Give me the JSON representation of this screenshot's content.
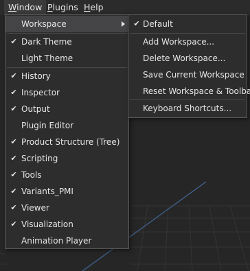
{
  "menubar": {
    "items": [
      {
        "label_first": "W",
        "label_rest": "indow"
      },
      {
        "label_first": "P",
        "label_rest": "lugins"
      },
      {
        "label_first": "H",
        "label_rest": "elp"
      }
    ]
  },
  "window_menu": {
    "workspace": "Workspace",
    "themes": [
      {
        "label": "Dark Theme",
        "checked": true
      },
      {
        "label": "Light Theme",
        "checked": false
      }
    ],
    "panels": [
      {
        "label": "History",
        "checked": true
      },
      {
        "label": "Inspector",
        "checked": true
      },
      {
        "label": "Output",
        "checked": true
      },
      {
        "label": "Plugin Editor",
        "checked": false
      },
      {
        "label": "Product Structure (Tree)",
        "checked": true
      },
      {
        "label": "Scripting",
        "checked": true
      },
      {
        "label": "Tools",
        "checked": true
      },
      {
        "label": "Variants_PMI",
        "checked": true
      },
      {
        "label": "Viewer",
        "checked": true
      },
      {
        "label": "Visualization",
        "checked": true
      },
      {
        "label": "Animation Player",
        "checked": false
      }
    ]
  },
  "workspace_menu": {
    "default": {
      "label": "Default",
      "checked": true
    },
    "actions": [
      "Add Workspace...",
      "Delete Workspace...",
      "Save Current Workspace",
      "Reset Workspace & Toolbar"
    ],
    "shortcuts": "Keyboard Shortcuts..."
  },
  "check_glyph": "✔",
  "colors": {
    "background": "#262626",
    "menu_bg": "#2d2d2d",
    "highlight": "#444446",
    "text": "#e6e6e6"
  }
}
